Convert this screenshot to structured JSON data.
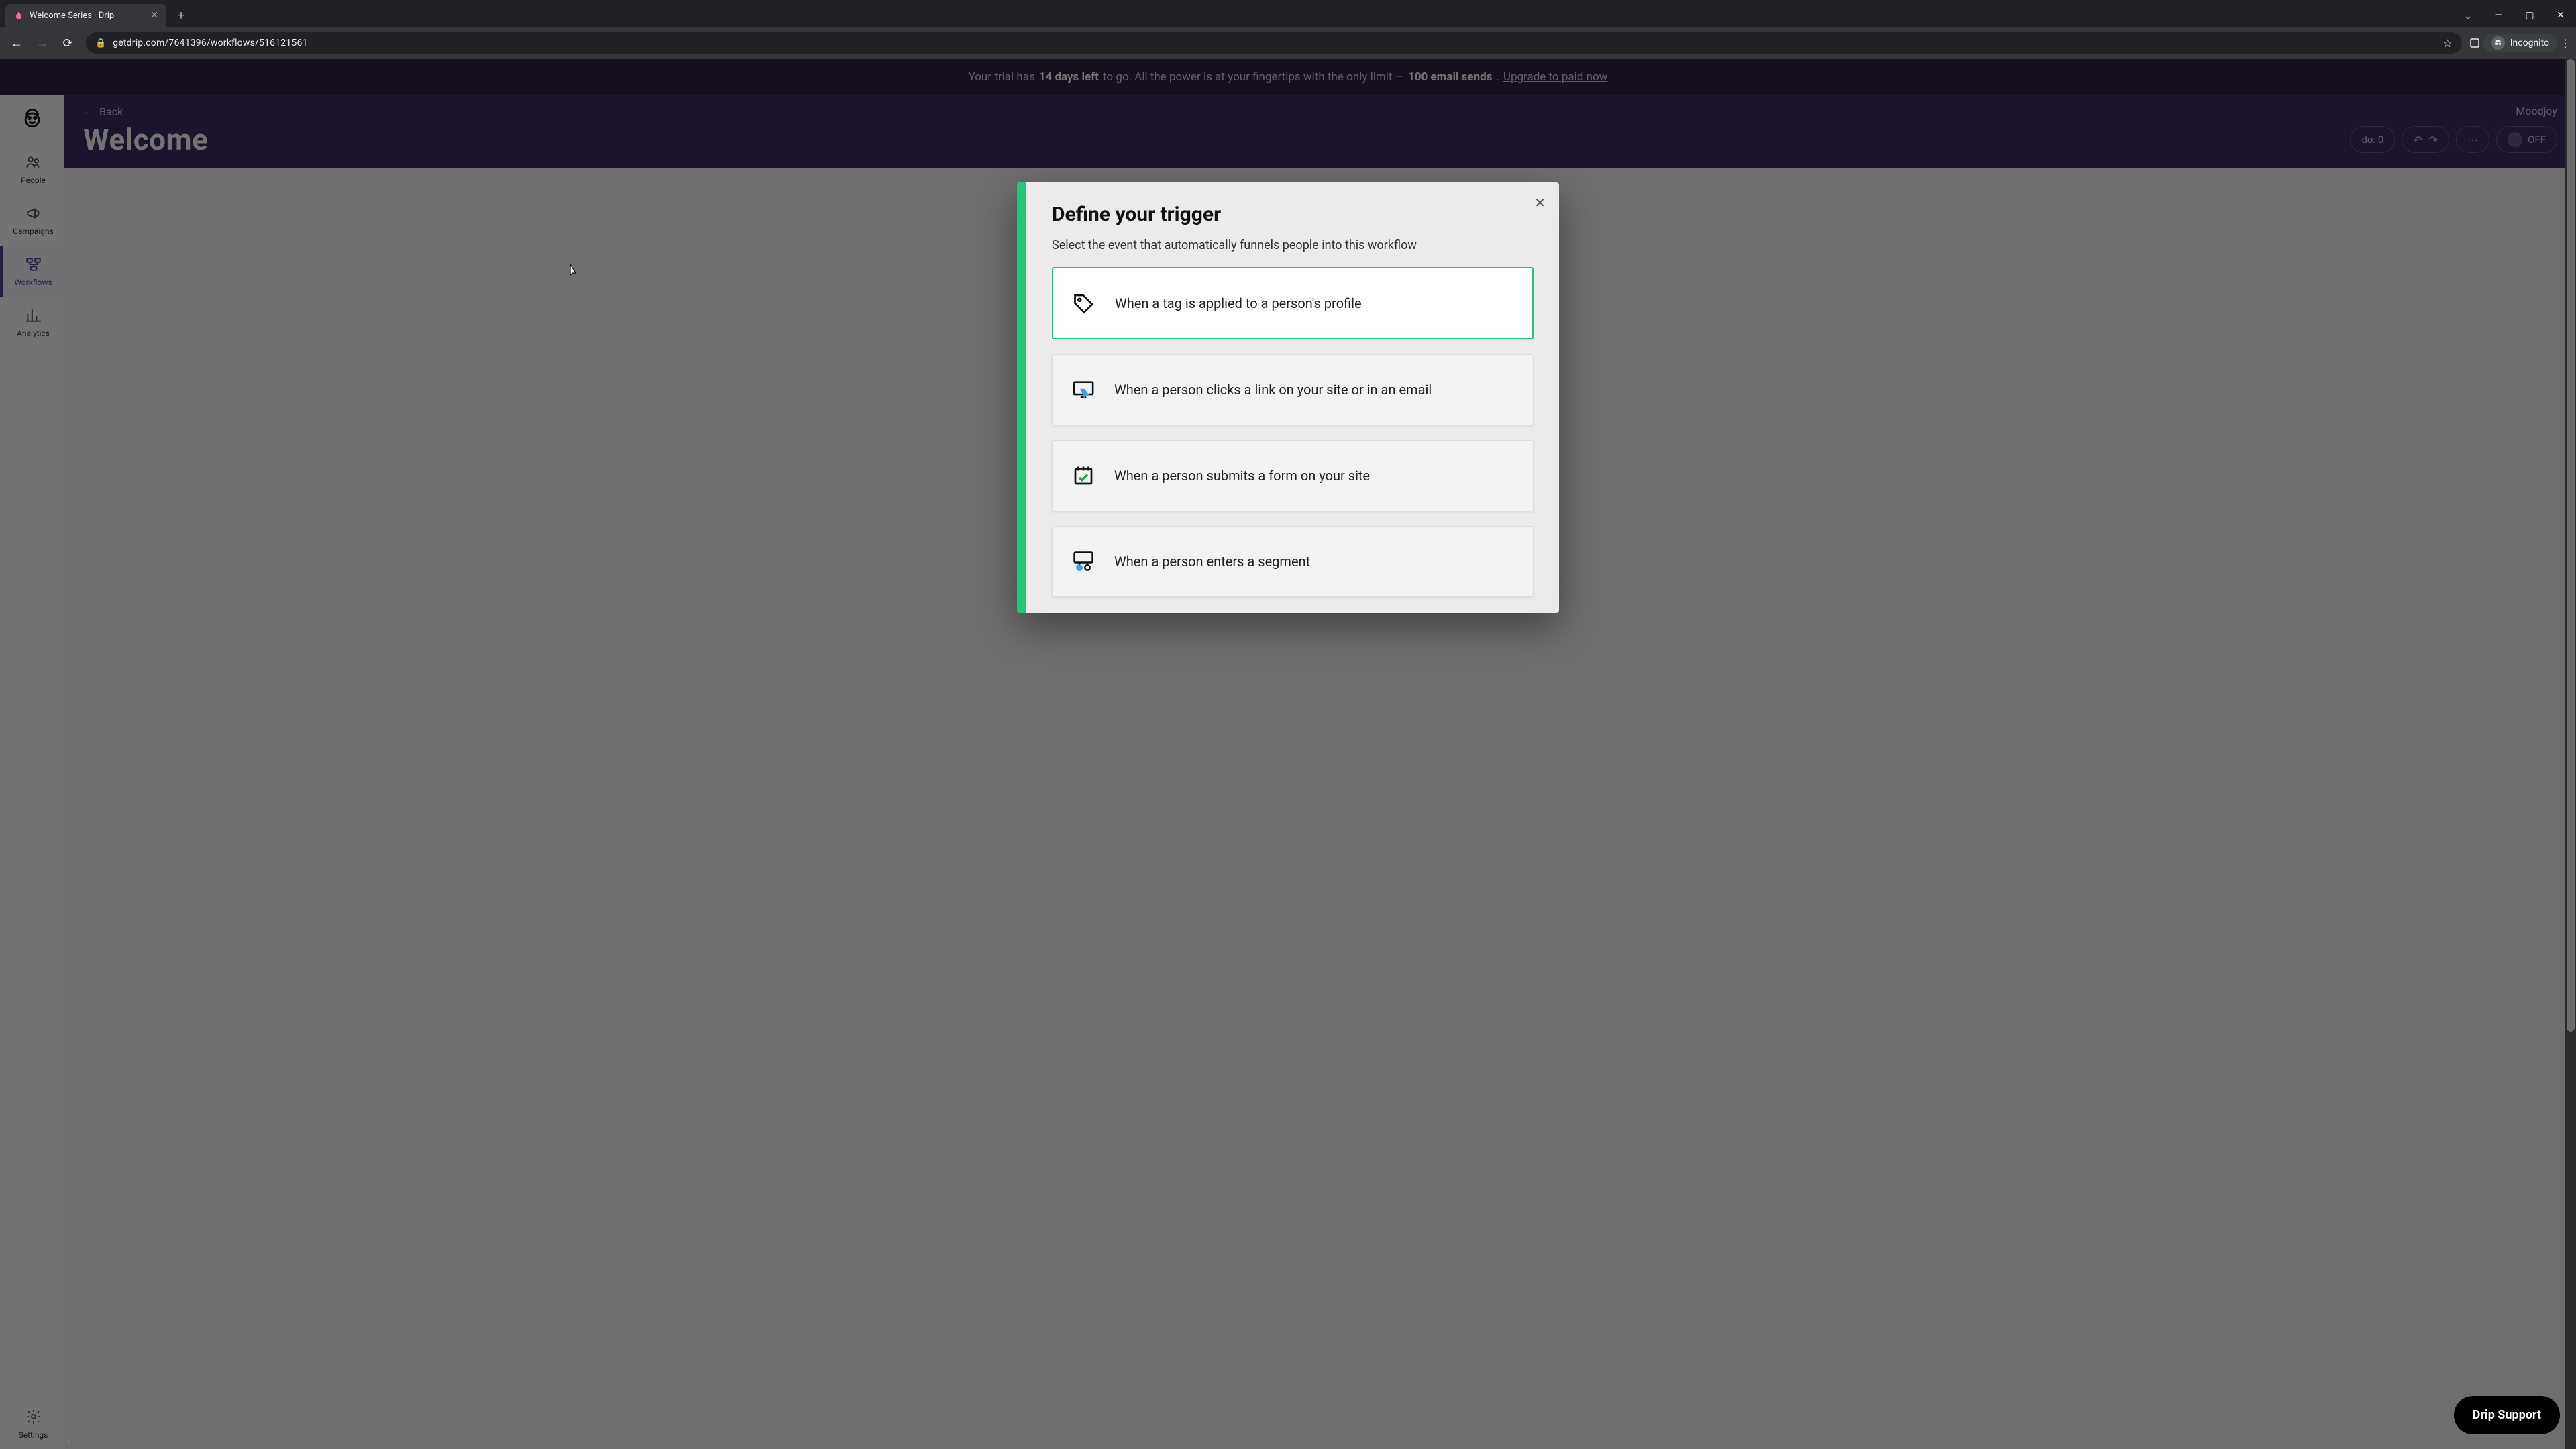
{
  "browser": {
    "tab_title": "Welcome Series · Drip",
    "url": "getdrip.com/7641396/workflows/516121561",
    "incognito_label": "Incognito"
  },
  "trial": {
    "prefix": "Your trial has ",
    "days": "14 days left",
    "mid": " to go. All the power is at your fingertips with the only limit — ",
    "limit": "100 email sends",
    "suffix": ". ",
    "cta": "Upgrade to paid now"
  },
  "sidebar": {
    "items": [
      {
        "label": "People"
      },
      {
        "label": "Campaigns"
      },
      {
        "label": "Workflows"
      },
      {
        "label": "Analytics"
      }
    ],
    "settings": "Settings"
  },
  "header": {
    "back": "Back",
    "title": "Welcome",
    "account": "Moodjoy",
    "todo": "do: 0",
    "toggle": "OFF"
  },
  "modal": {
    "title": "Define your trigger",
    "subtitle": "Select the event that automatically funnels people into this workflow",
    "options": [
      "When a tag is applied to a person's profile",
      "When a person clicks a link on your site or in an email",
      "When a person submits a form on your site",
      "When a person enters a segment"
    ]
  },
  "support": {
    "label": "Drip Support"
  }
}
